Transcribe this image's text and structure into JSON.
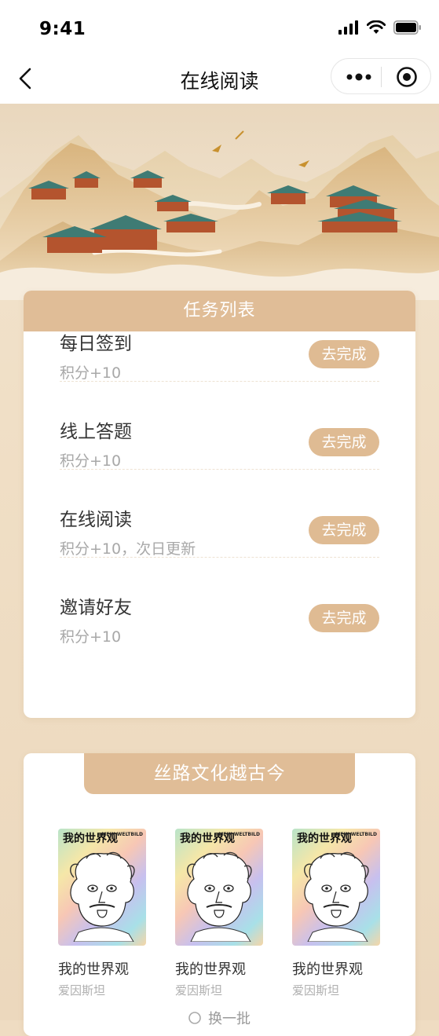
{
  "status_bar": {
    "time": "9:41"
  },
  "nav": {
    "title": "在线阅读"
  },
  "task_card": {
    "header": "任务列表",
    "items": [
      {
        "title": "每日签到",
        "sub": "积分+10",
        "button": "去完成"
      },
      {
        "title": "线上答题",
        "sub": "积分+10",
        "button": "去完成"
      },
      {
        "title": "在线阅读",
        "sub": "积分+10，次日更新",
        "button": "去完成"
      },
      {
        "title": "邀请好友",
        "sub": "积分+10",
        "button": "去完成"
      }
    ]
  },
  "book_card": {
    "header": "丝路文化越古今",
    "books": [
      {
        "cover_title": "我的世界观",
        "cover_en": "MEIN WELTBILD",
        "title": "我的世界观",
        "author": "爱因斯坦"
      },
      {
        "cover_title": "我的世界观",
        "cover_en": "MEIN WELTBILD",
        "title": "我的世界观",
        "author": "爱因斯坦"
      },
      {
        "cover_title": "我的世界观",
        "cover_en": "MEIN WELTBILD",
        "title": "我的世界观",
        "author": "爱因斯坦"
      }
    ],
    "refresh": "换一批"
  },
  "colors": {
    "accent": "#dfbb93",
    "background": "#efdcc2"
  }
}
